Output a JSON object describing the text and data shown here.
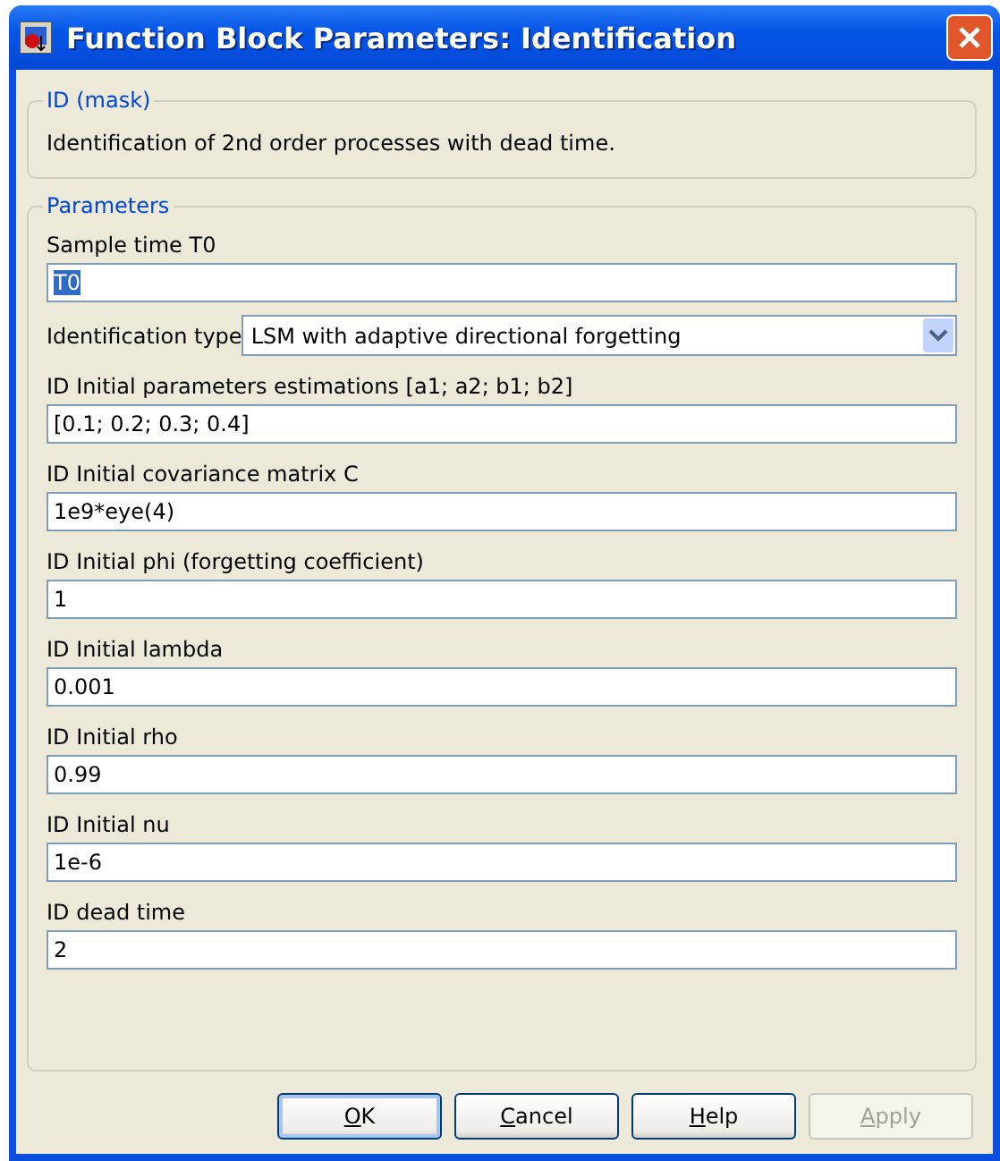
{
  "window": {
    "title": "Function Block Parameters: Identification"
  },
  "description_group": {
    "title": "ID (mask)",
    "text": "Identification of 2nd order processes with dead time."
  },
  "parameters_group": {
    "title": "Parameters",
    "fields": [
      {
        "kind": "text",
        "label": "Sample time T0",
        "value": "T0",
        "selected": true
      },
      {
        "kind": "dropdown",
        "label": "Identification type",
        "value": "LSM with adaptive directional forgetting"
      },
      {
        "kind": "text",
        "label": "ID Initial parameters estimations [a1; a2; b1; b2]",
        "value": "[0.1; 0.2; 0.3; 0.4]",
        "selected": false
      },
      {
        "kind": "text",
        "label": "ID Initial covariance matrix C",
        "value": "1e9*eye(4)",
        "selected": false
      },
      {
        "kind": "text",
        "label": "ID Initial phi (forgetting coefficient)",
        "value": "1",
        "selected": false
      },
      {
        "kind": "text",
        "label": "ID Initial lambda",
        "value": "0.001",
        "selected": false
      },
      {
        "kind": "text",
        "label": "ID Initial rho",
        "value": "0.99",
        "selected": false
      },
      {
        "kind": "text",
        "label": "ID Initial nu",
        "value": "1e-6",
        "selected": false
      },
      {
        "kind": "text",
        "label": "ID dead time",
        "value": "2",
        "selected": false
      }
    ]
  },
  "buttons": [
    {
      "label": "OK",
      "disabled": false,
      "default": true
    },
    {
      "label": "Cancel",
      "disabled": false,
      "default": false
    },
    {
      "label": "Help",
      "disabled": false,
      "default": false
    },
    {
      "label": "Apply",
      "disabled": true,
      "default": false
    }
  ]
}
